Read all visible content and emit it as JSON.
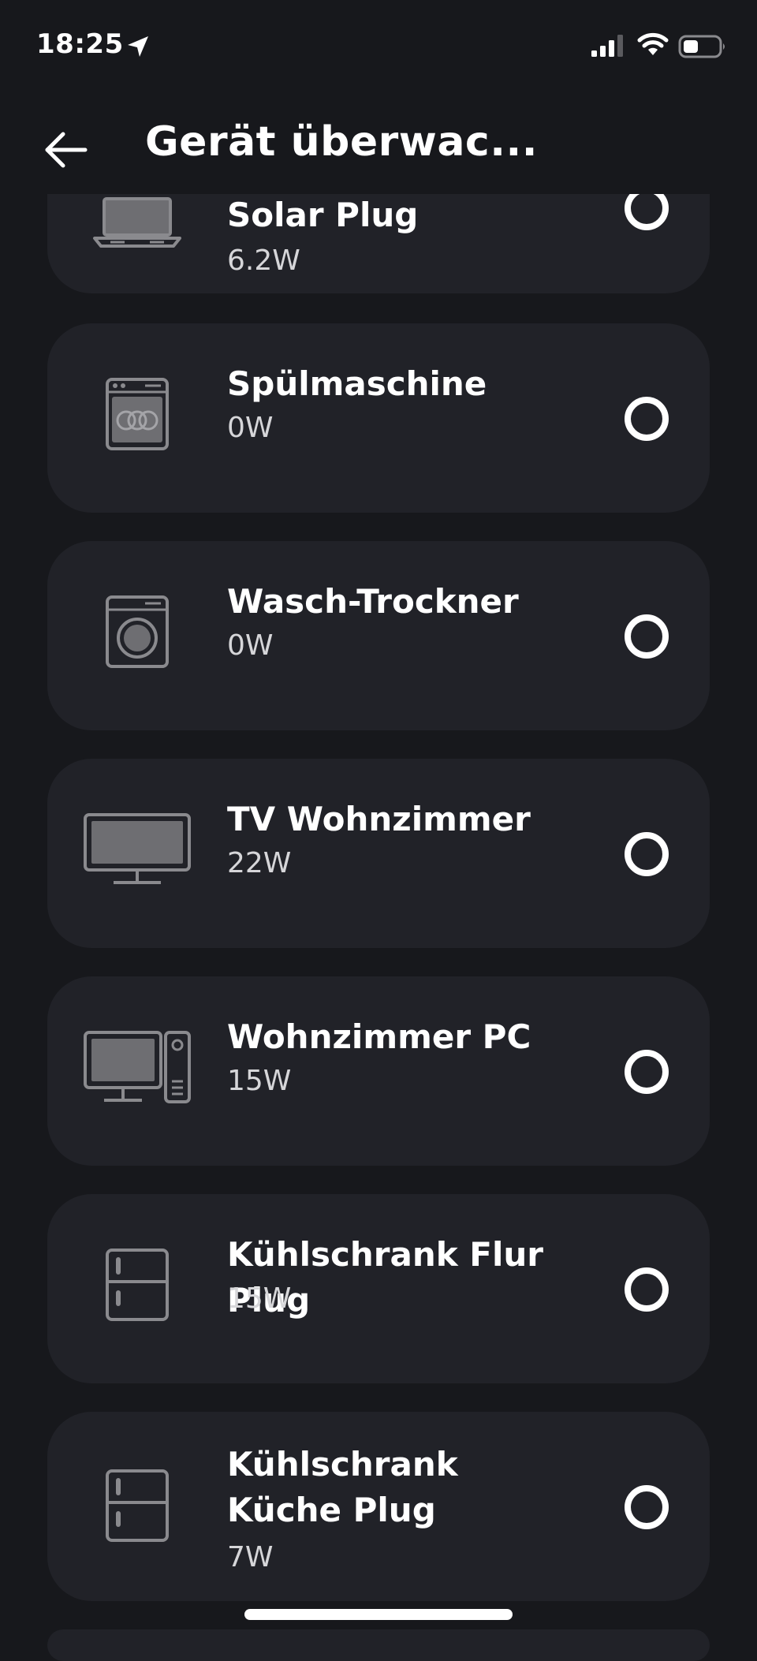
{
  "status": {
    "time": "18:25"
  },
  "header": {
    "title": "Gerät überwac..."
  },
  "devices": [
    {
      "name": "Solar Plug",
      "power": "6.2W",
      "icon": "laptop-icon"
    },
    {
      "name": "Spülmaschine",
      "power": "0W",
      "icon": "dishwasher-icon"
    },
    {
      "name": "Wasch-Trockner",
      "power": "0W",
      "icon": "washing-machine-icon"
    },
    {
      "name": "TV Wohnzimmer",
      "power": "22W",
      "icon": "tv-icon"
    },
    {
      "name": "Wohnzimmer PC",
      "power": "15W",
      "icon": "desktop-pc-icon"
    },
    {
      "name": "Kühlschrank Flur Plug",
      "power": "15W",
      "icon": "fridge-icon"
    },
    {
      "name": "Kühlschrank Küche Plug",
      "power": "7W",
      "icon": "fridge-icon"
    }
  ],
  "colors": {
    "background": "#17181c",
    "card": "#212228",
    "icon": "#8a8a8e"
  }
}
